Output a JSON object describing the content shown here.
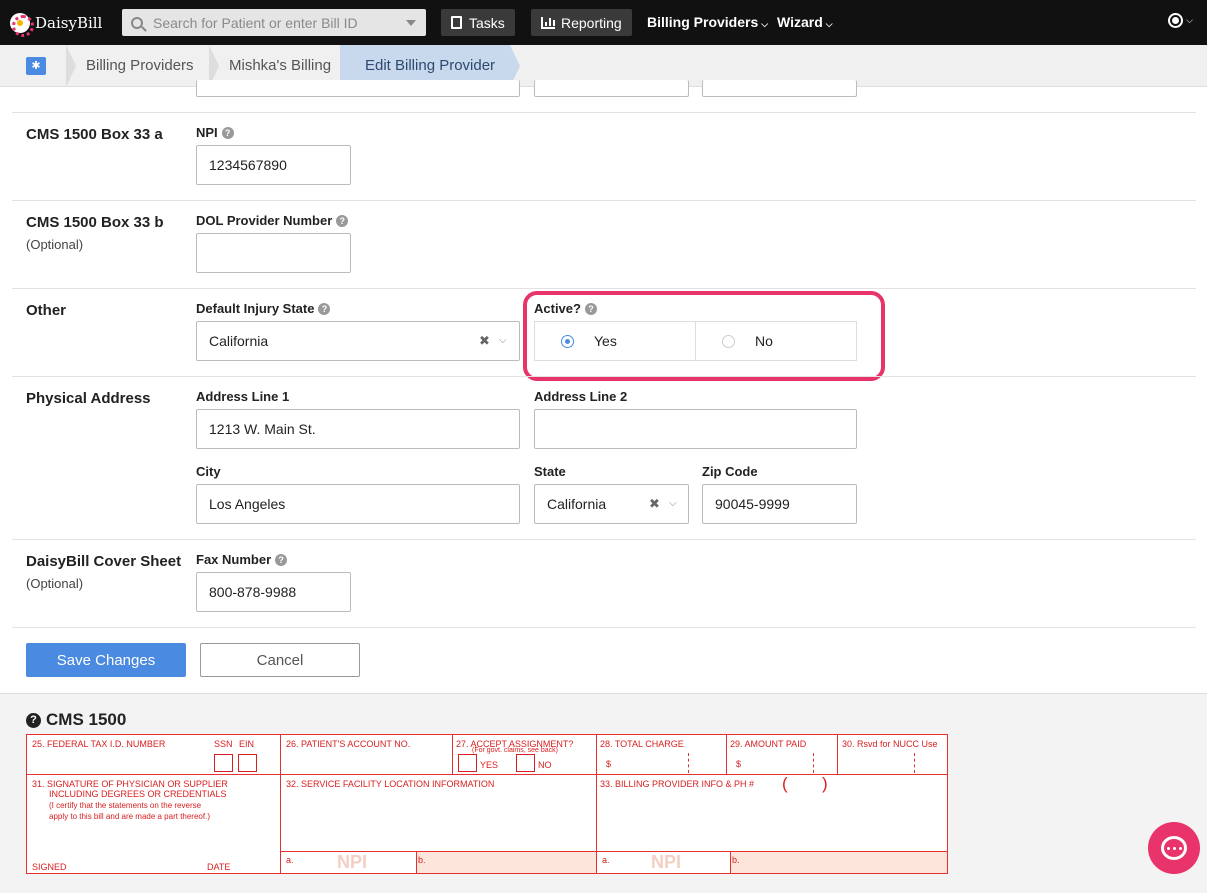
{
  "app": {
    "brand": "DaisyBill"
  },
  "nav": {
    "search_placeholder": "Search for Patient or enter Bill ID",
    "tasks": "Tasks",
    "reporting": "Reporting",
    "billing_providers": "Billing Providers",
    "wizard": "Wizard"
  },
  "breadcrumb": [
    "Billing Providers",
    "Mishka's Billing",
    "Edit Billing Provider"
  ],
  "form": {
    "box33a": {
      "title": "CMS 1500 Box 33 a",
      "npi_label": "NPI",
      "npi_value": "1234567890"
    },
    "box33b": {
      "title": "CMS 1500 Box 33 b",
      "optional": "(Optional)",
      "dol_label": "DOL Provider Number",
      "dol_value": ""
    },
    "other": {
      "title": "Other",
      "injury_state_label": "Default Injury State",
      "injury_state_value": "California",
      "active_label": "Active?",
      "active_yes": "Yes",
      "active_no": "No",
      "active_selected": "Yes"
    },
    "physical_address": {
      "title": "Physical Address",
      "line1_label": "Address Line 1",
      "line1_value": "1213 W. Main St.",
      "line2_label": "Address Line 2",
      "line2_value": "",
      "city_label": "City",
      "city_value": "Los Angeles",
      "state_label": "State",
      "state_value": "California",
      "zip_label": "Zip Code",
      "zip_value": "90045-9999"
    },
    "cover_sheet": {
      "title": "DaisyBill Cover Sheet",
      "optional": "(Optional)",
      "fax_label": "Fax Number",
      "fax_value": "800-878-9988"
    },
    "save": "Save Changes",
    "cancel": "Cancel"
  },
  "cms1500": {
    "title": "CMS 1500",
    "f25": "25. FEDERAL TAX I.D. NUMBER",
    "ssn": "SSN",
    "ein": "EIN",
    "f26": "26. PATIENT'S ACCOUNT NO.",
    "f27": "27. ACCEPT ASSIGNMENT?",
    "f27_sub": "(For govt. claims, see back)",
    "yes": "YES",
    "no": "NO",
    "f28": "28. TOTAL CHARGE",
    "f29": "29. AMOUNT PAID",
    "f30": "30. Rsvd for NUCC Use",
    "dollar": "$",
    "f31_line1": "31. SIGNATURE OF PHYSICIAN OR SUPPLIER",
    "f31_line2": "INCLUDING DEGREES OR CREDENTIALS",
    "f31_line3": "(I certify that the statements on the reverse",
    "f31_line4": "apply to this bill and are made a part thereof.)",
    "signed": "SIGNED",
    "date": "DATE",
    "f32": "32. SERVICE FACILITY LOCATION INFORMATION",
    "f33": "33. BILLING PROVIDER INFO & PH #",
    "paren_open": "(",
    "paren_close": ")",
    "a": "a.",
    "b": "b.",
    "npi": "NPI"
  },
  "colors": {
    "accent": "#4a8ae0",
    "highlight": "#e8336b",
    "form_red": "#e63030"
  }
}
